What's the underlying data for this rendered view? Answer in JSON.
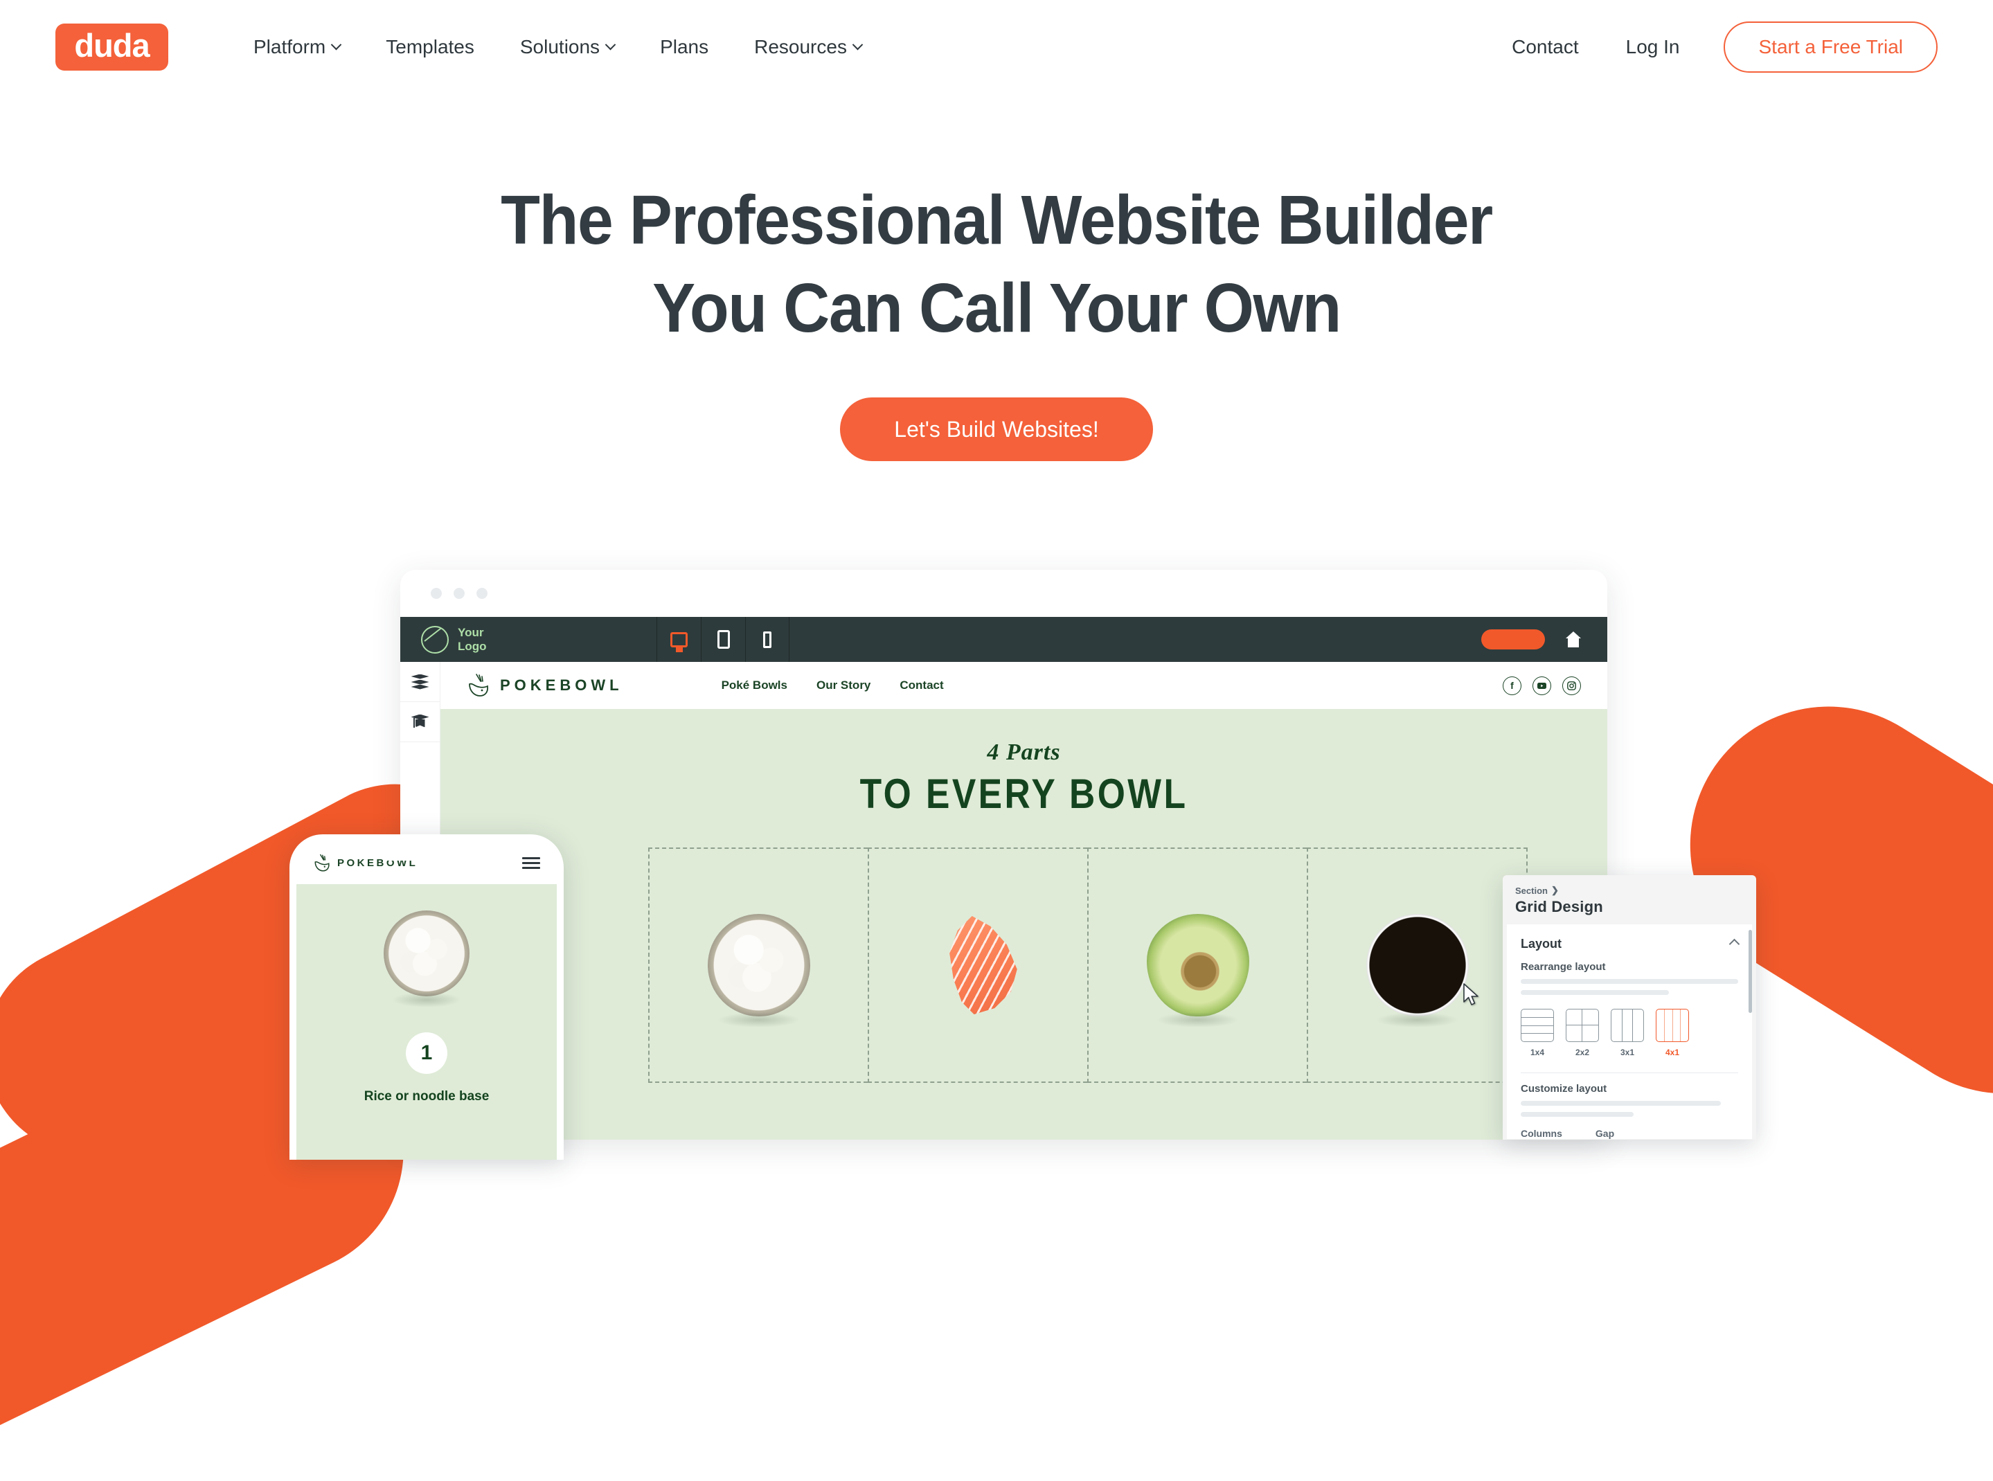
{
  "navbar": {
    "logo_text": "duda",
    "logo_bg": "#F4613A",
    "links": [
      {
        "label": "Platform",
        "caret": true
      },
      {
        "label": "Templates",
        "caret": false
      },
      {
        "label": "Solutions",
        "caret": true
      },
      {
        "label": "Plans",
        "caret": false
      },
      {
        "label": "Resources",
        "caret": true
      }
    ],
    "right_links": [
      {
        "label": "Contact"
      },
      {
        "label": "Log In"
      }
    ],
    "trial_button": "Start a Free Trial"
  },
  "hero": {
    "title_line1": "The Professional Website Builder",
    "title_line2": "You Can Call Your Own",
    "cta_label": "Let's Build Websites!",
    "title_color": "#323C42",
    "accent_color": "#F4613A"
  },
  "editor": {
    "toolbar": {
      "logo_label_line1": "Your",
      "logo_label_line2": "Logo",
      "devices": [
        {
          "name": "desktop",
          "active": true
        },
        {
          "name": "tablet",
          "active": false
        },
        {
          "name": "mobile",
          "active": false
        }
      ]
    },
    "sidebar_icons": [
      "layers-icon",
      "graduation-cap-icon"
    ],
    "site": {
      "brand": "POKEBOWL",
      "nav": [
        "Poké Bowls",
        "Our Story",
        "Contact"
      ],
      "socials": [
        "facebook-icon",
        "youtube-icon",
        "instagram-icon"
      ],
      "heading_script": "4 Parts",
      "heading_main": "TO EVERY BOWL",
      "bg_color": "#DFEBD7",
      "text_color": "#14441F",
      "grid_items": [
        {
          "name": "rice-bowl"
        },
        {
          "name": "salmon-slices"
        },
        {
          "name": "avocado-half"
        },
        {
          "name": "soy-sauce-bowl"
        }
      ]
    }
  },
  "phone": {
    "brand": "POKEBOWL",
    "step_number": "1",
    "caption": "Rice or noodle base"
  },
  "panel": {
    "breadcrumb": "Section",
    "breadcrumb_arrow": "❯",
    "title": "Grid Design",
    "section_label": "Layout",
    "rearrange_label": "Rearrange layout",
    "layouts": [
      {
        "label": "1x4",
        "type": "rows",
        "cells": 4,
        "selected": false
      },
      {
        "label": "2x2",
        "type": "quad",
        "cells": 4,
        "selected": false
      },
      {
        "label": "3x1",
        "type": "cols",
        "cells": 3,
        "selected": false
      },
      {
        "label": "4x1",
        "type": "cols",
        "cells": 4,
        "selected": true
      }
    ],
    "customize_label": "Customize layout",
    "field_labels": [
      "Columns",
      "Gap"
    ],
    "selected_color": "#F1592A"
  }
}
